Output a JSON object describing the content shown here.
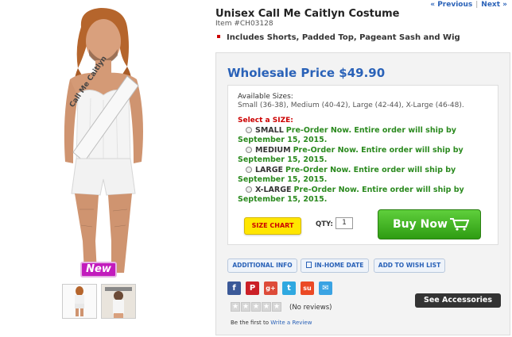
{
  "nav": {
    "previous": "« Previous",
    "next": "Next »"
  },
  "product": {
    "title": "Unisex Call Me Caitlyn Costume",
    "item_number": "Item #CH03128",
    "features": [
      "Includes Shorts, Padded Top, Pageant Sash and Wig"
    ],
    "sash_text": "Call Me Caitlyn",
    "badge": "New"
  },
  "price": {
    "label": "Wholesale Price $49.90"
  },
  "sizes": {
    "available_label": "Available Sizes:",
    "available_list": "Small (36-38), Medium (40-42), Large (42-44), X-Large (46-48).",
    "select_label": "Select a SIZE:",
    "options": [
      {
        "size": "SMALL",
        "message": "Pre-Order Now. Entire order will ship by September 15, 2015."
      },
      {
        "size": "MEDIUM",
        "message": "Pre-Order Now. Entire order will ship by September 15, 2015."
      },
      {
        "size": "LARGE",
        "message": "Pre-Order Now. Entire order will ship by September 15, 2015."
      },
      {
        "size": "X-LARGE",
        "message": "Pre-Order Now. Entire order will ship by September 15, 2015."
      }
    ]
  },
  "purchase": {
    "size_chart": "SIZE CHART",
    "qty_label": "QTY:",
    "qty_value": "1",
    "buy_now": "Buy Now"
  },
  "tabs": [
    "ADDITIONAL INFO",
    "IN-HOME DATE",
    "ADD TO WISH LIST"
  ],
  "social_icons": [
    "facebook-icon",
    "pinterest-icon",
    "google-plus-icon",
    "twitter-icon",
    "stumbleupon-icon",
    "email-icon"
  ],
  "reviews": {
    "count_text": "(No reviews)",
    "first_prefix": "Be the first to",
    "write_link": "Write a Review",
    "rating": 0,
    "max_rating": 5
  },
  "see_accessories": "See Accessories",
  "colors": {
    "price_blue": "#2a62b8",
    "ship_green": "#2b8a1f",
    "select_red": "#cc0000",
    "buy_green": "#3aae1a",
    "size_chart_yellow": "#ffe600",
    "badge_magenta": "#c21bbd"
  }
}
